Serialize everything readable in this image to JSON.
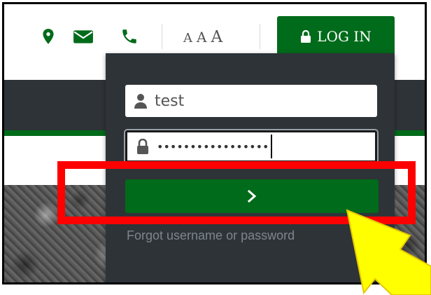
{
  "topbar": {
    "icons": [
      "map-marker-icon",
      "envelope-icon",
      "phone-icon"
    ],
    "text_size": [
      "A",
      "A",
      "A"
    ],
    "login_tab_label": "LOG IN"
  },
  "login_form": {
    "username_value": "test",
    "password_mask": "•••••••••••••••••",
    "forgot_link": "Forgot username or password"
  },
  "annotations": {
    "highlight": "red-rectangle",
    "pointer": "yellow-arrow"
  },
  "colors": {
    "brand_green": "#006b1a",
    "dark_panel": "#2e3338",
    "highlight_red": "#ff0000",
    "arrow_yellow": "#ffff00"
  }
}
